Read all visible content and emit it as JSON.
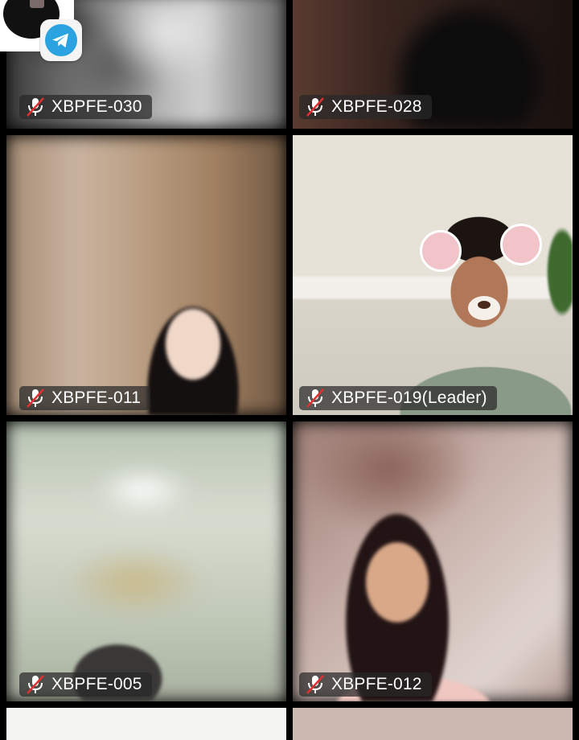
{
  "participants": [
    {
      "name": "XBPFE-030",
      "muted": true
    },
    {
      "name": "XBPFE-028",
      "muted": true
    },
    {
      "name": "XBPFE-011",
      "muted": true
    },
    {
      "name": "XBPFE-019(Leader)",
      "muted": true
    },
    {
      "name": "XBPFE-005",
      "muted": true
    },
    {
      "name": "XBPFE-012",
      "muted": true
    }
  ],
  "overlay": {
    "icon": "telegram-icon"
  },
  "colors": {
    "background": "#000000",
    "mute_slash": "#e03030",
    "telegram_blue": "#2aa3e0"
  }
}
